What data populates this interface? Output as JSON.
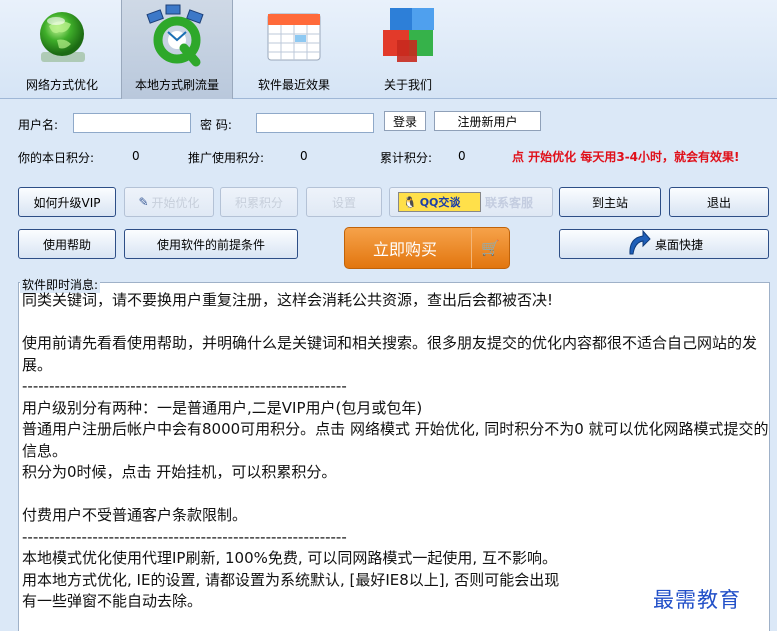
{
  "tabs": [
    {
      "label": "网络方式优化",
      "icon": "globe-icon"
    },
    {
      "label": "本地方式刷流量",
      "icon": "network-q-icon",
      "active": true
    },
    {
      "label": "软件最近效果",
      "icon": "calendar-icon"
    },
    {
      "label": "关于我们",
      "icon": "cubes-icon"
    }
  ],
  "login": {
    "username_label": "用户名:",
    "username_value": "",
    "password_label": "密  码:",
    "password_value": "",
    "login_button": "登录",
    "register_button": "注册新用户"
  },
  "stats": {
    "today_label": "你的本日积分:",
    "today_value": "0",
    "promo_label": "推广使用积分:",
    "promo_value": "0",
    "total_label": "累计积分:",
    "total_value": "0",
    "hint": "点 开始优化 每天用3-4小时，就会有效果!"
  },
  "buttons": {
    "upgrade_vip": "如何升级VIP",
    "start_optimize": "开始优化",
    "earn_points": "积累积分",
    "settings": "设置",
    "qq_badge": "QQ交谈",
    "contact_service": "联系客服",
    "go_home": "到主站",
    "exit": "退出",
    "help": "使用帮助",
    "prerequisites": "使用软件的前提条件",
    "buy_now": "立即购买",
    "desktop_shortcut": "桌面快捷"
  },
  "messages": {
    "title": "软件即时消息:",
    "body": "同类关键词，请不要换用户重复注册，这样会消耗公共资源，查出后会都被否决!\n\n使用前请先看看使用帮助，并明确什么是关键词和相关搜索。很多朋友提交的优化内容都很不适合自己网站的发展。\n------------------------------------------------------------\n用户级别分有两种：一是普通用户,二是VIP用户(包月或包年)\n普通用户注册后帐户中会有8000可用积分。点击 网络模式 开始优化, 同时积分不为0 就可以优化网路模式提交的信息。\n积分为0时候，点击 开始挂机，可以积累积分。\n\n付费用户不受普通客户条款限制。\n------------------------------------------------------------\n本地模式优化使用代理IP刷新, 100%免费, 可以同网路模式一起使用, 互不影响。\n用本地方式优化, IE的设置, 请都设置为系统默认, [最好IE8以上], 否则可能会出现\n有一些弹窗不能自动去除。"
  },
  "watermark": "最需教育",
  "colors": {
    "background": "#dbe8f7",
    "hint_red": "#e0101a",
    "buy_orange": "#e2760f",
    "button_border": "#2d4e86"
  }
}
